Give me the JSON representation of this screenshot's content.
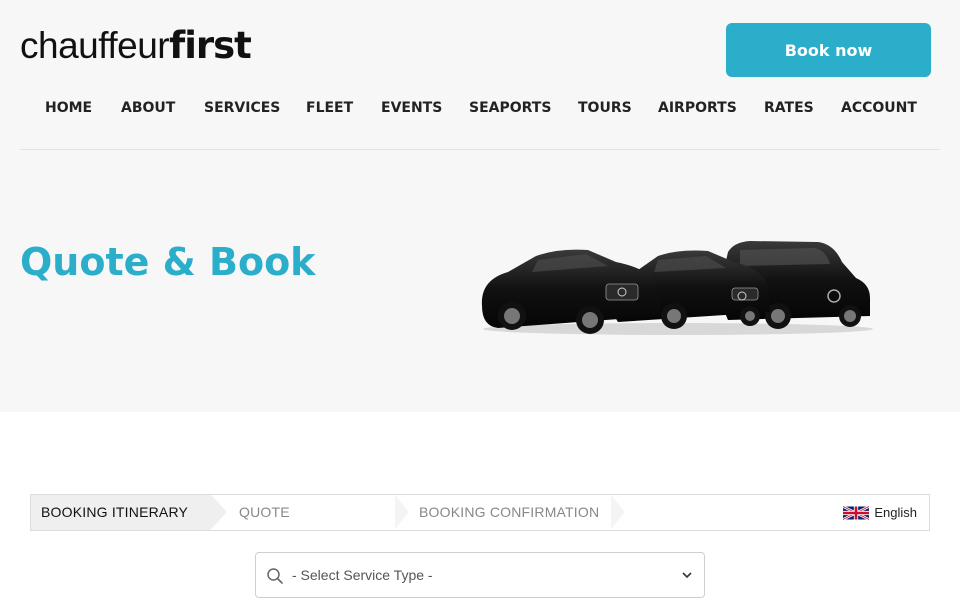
{
  "header": {
    "logo_light": "chauffeur",
    "logo_bold": "first",
    "book_button": "Book now",
    "accent_color": "#2aaec9"
  },
  "nav": {
    "items": [
      {
        "label": "HOME"
      },
      {
        "label": "ABOUT"
      },
      {
        "label": "SERVICES"
      },
      {
        "label": "FLEET"
      },
      {
        "label": "EVENTS"
      },
      {
        "label": "SEAPORTS"
      },
      {
        "label": "TOURS"
      },
      {
        "label": "AIRPORTS"
      },
      {
        "label": "RATES"
      },
      {
        "label": "ACCOUNT"
      }
    ]
  },
  "hero": {
    "title": "Quote & Book",
    "image": "luxury-cars-image"
  },
  "booking": {
    "steps": [
      {
        "label": "BOOKING ITINERARY",
        "active": true
      },
      {
        "label": "QUOTE",
        "active": false
      },
      {
        "label": "BOOKING CONFIRMATION",
        "active": false
      }
    ],
    "language": "English",
    "language_flag": "uk-flag-icon",
    "service_select": {
      "selected": "- Select Service Type -",
      "icon": "search-icon"
    }
  }
}
